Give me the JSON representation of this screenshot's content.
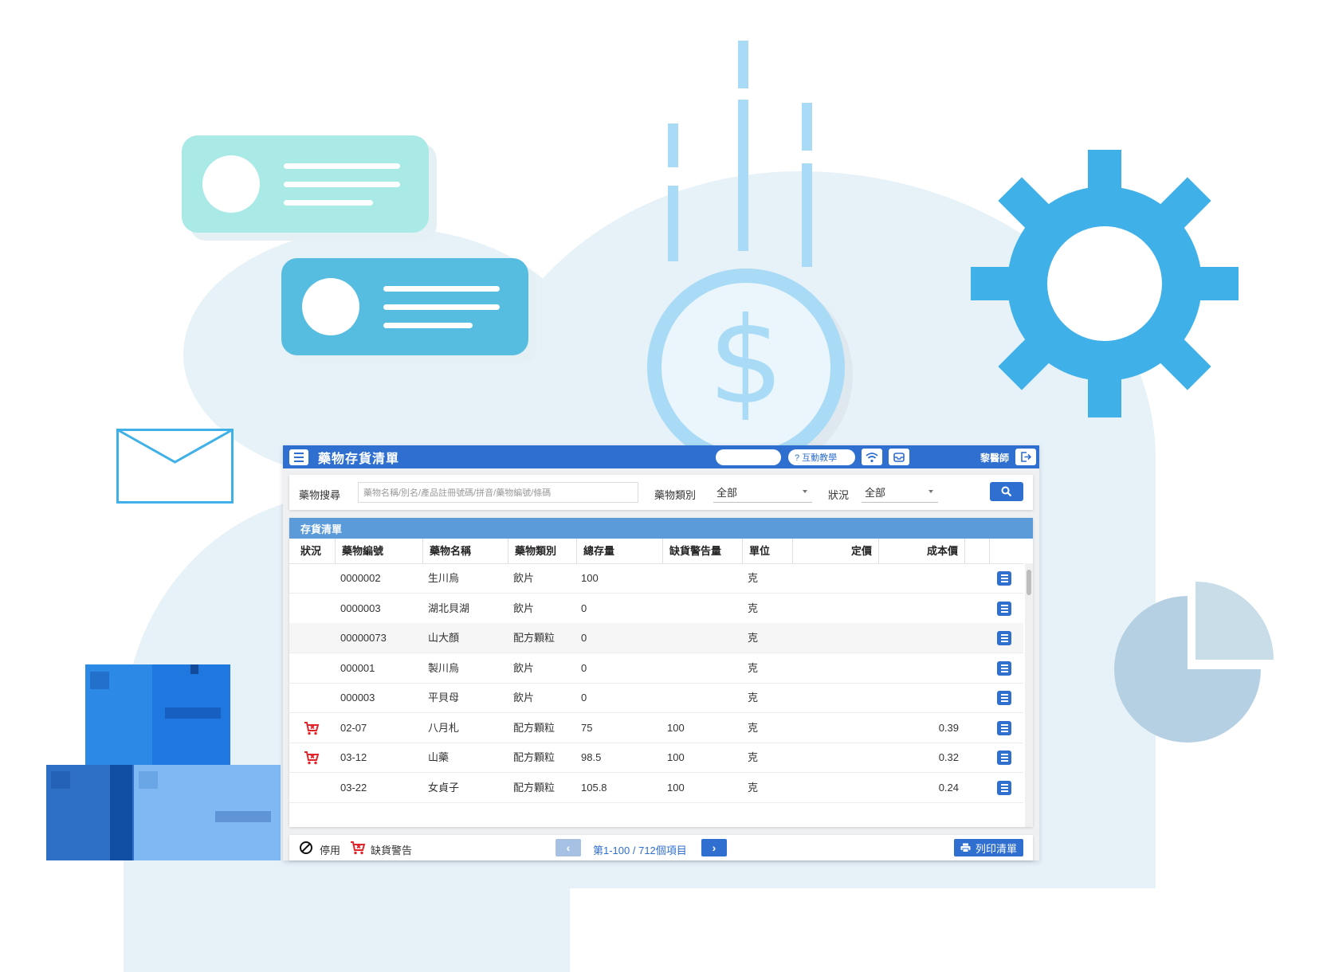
{
  "app": {
    "title": "藥物存貨清單",
    "tutorial_label": "? 互動教學",
    "user_name": "黎醫師"
  },
  "search": {
    "drug_search_label": "藥物搜尋",
    "drug_search_placeholder": "藥物名稱/別名/產品註冊號碼/拼音/藥物編號/條碼",
    "category_label": "藥物類別",
    "category_value": "全部",
    "status_label": "狀況",
    "status_value": "全部"
  },
  "inventory": {
    "panel_title": "存貨清單",
    "columns": [
      "狀況",
      "藥物編號",
      "藥物名稱",
      "藥物類別",
      "總存量",
      "缺貨警告量",
      "單位",
      "定價",
      "成本價"
    ],
    "rows": [
      {
        "status_icon": "",
        "code": "0000002",
        "name": "生川烏",
        "category": "飲片",
        "stock": "100",
        "alert": "",
        "unit": "克",
        "price": "",
        "cost": ""
      },
      {
        "status_icon": "",
        "code": "0000003",
        "name": "湖北貝湖",
        "category": "飲片",
        "stock": "0",
        "alert": "",
        "unit": "克",
        "price": "",
        "cost": ""
      },
      {
        "status_icon": "",
        "code": "00000073",
        "name": "山大顏",
        "category": "配方顆粒",
        "stock": "0",
        "alert": "",
        "unit": "克",
        "price": "",
        "cost": ""
      },
      {
        "status_icon": "",
        "code": "000001",
        "name": "製川烏",
        "category": "飲片",
        "stock": "0",
        "alert": "",
        "unit": "克",
        "price": "",
        "cost": ""
      },
      {
        "status_icon": "",
        "code": "000003",
        "name": "平貝母",
        "category": "飲片",
        "stock": "0",
        "alert": "",
        "unit": "克",
        "price": "",
        "cost": ""
      },
      {
        "status_icon": "cart-warning-icon",
        "code": "02-07",
        "name": "八月札",
        "category": "配方顆粒",
        "stock": "75",
        "alert": "100",
        "unit": "克",
        "price": "",
        "cost": "0.39"
      },
      {
        "status_icon": "cart-warning-icon",
        "code": "03-12",
        "name": "山藥",
        "category": "配方顆粒",
        "stock": "98.5",
        "alert": "100",
        "unit": "克",
        "price": "",
        "cost": "0.32"
      },
      {
        "status_icon": "",
        "code": "03-22",
        "name": "女貞子",
        "category": "配方顆粒",
        "stock": "105.8",
        "alert": "100",
        "unit": "克",
        "price": "",
        "cost": "0.24"
      }
    ]
  },
  "footer": {
    "disabled_label": "停用",
    "shortage_label": "缺貨警告",
    "pagination_text": "第1-100 / 712個項目",
    "print_label": "列印清單"
  },
  "colors": {
    "primary": "#2f6fd0",
    "panel_header": "#5b9bd9",
    "warning": "#e0262b",
    "gear": "#3fb0e8",
    "card_teal": "#a9e9e6",
    "card_blue": "#56bde0"
  },
  "icons": [
    "menu-icon",
    "wifi-icon",
    "inbox-icon",
    "logout-icon",
    "search-icon",
    "cart-warning-icon",
    "detail-icon",
    "disabled-icon",
    "print-icon",
    "chevron-left-icon",
    "chevron-right-icon",
    "gear-icon",
    "dollar-coin-icon",
    "envelope-icon",
    "pie-chart-icon",
    "box-icon"
  ]
}
